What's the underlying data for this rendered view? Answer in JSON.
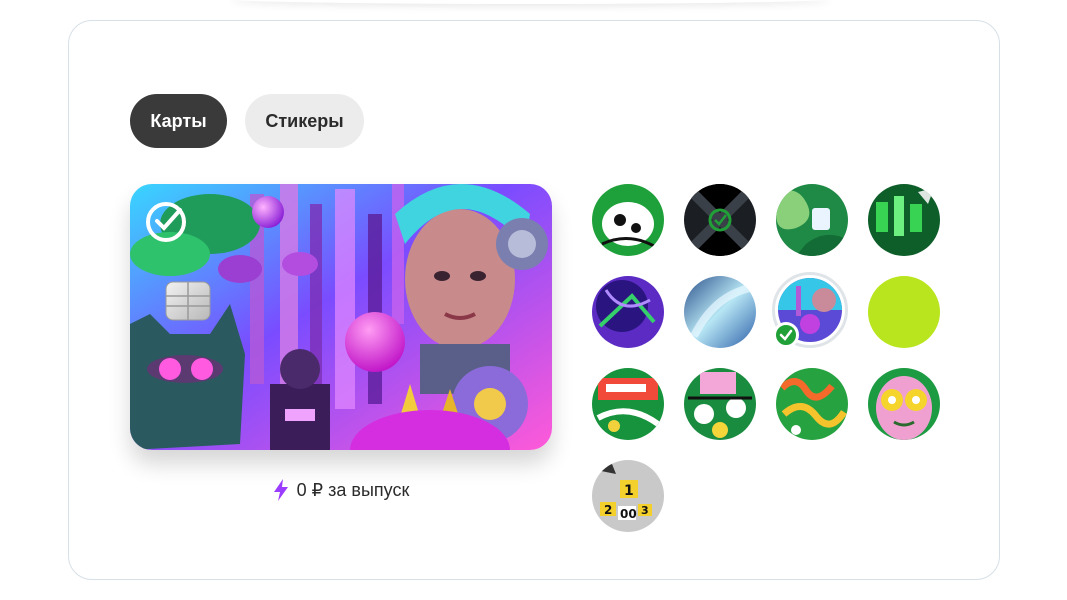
{
  "tabs": [
    {
      "label": "Карты",
      "active": true
    },
    {
      "label": "Стикеры",
      "active": false
    }
  ],
  "card": {
    "price_text": "0 ₽ за выпуск",
    "accent_color": "#9b3dff"
  },
  "designs": {
    "selected_index": 6,
    "items": [
      {
        "name": "design-1"
      },
      {
        "name": "design-2"
      },
      {
        "name": "design-3"
      },
      {
        "name": "design-4"
      },
      {
        "name": "design-5"
      },
      {
        "name": "design-6"
      },
      {
        "name": "design-7"
      },
      {
        "name": "design-8"
      },
      {
        "name": "design-9"
      },
      {
        "name": "design-10"
      },
      {
        "name": "design-11"
      },
      {
        "name": "design-12"
      },
      {
        "name": "design-13"
      }
    ]
  },
  "colors": {
    "brand_green": "#21a038",
    "tab_active_bg": "#3a3a3a",
    "tab_inactive_bg": "#ececec"
  }
}
